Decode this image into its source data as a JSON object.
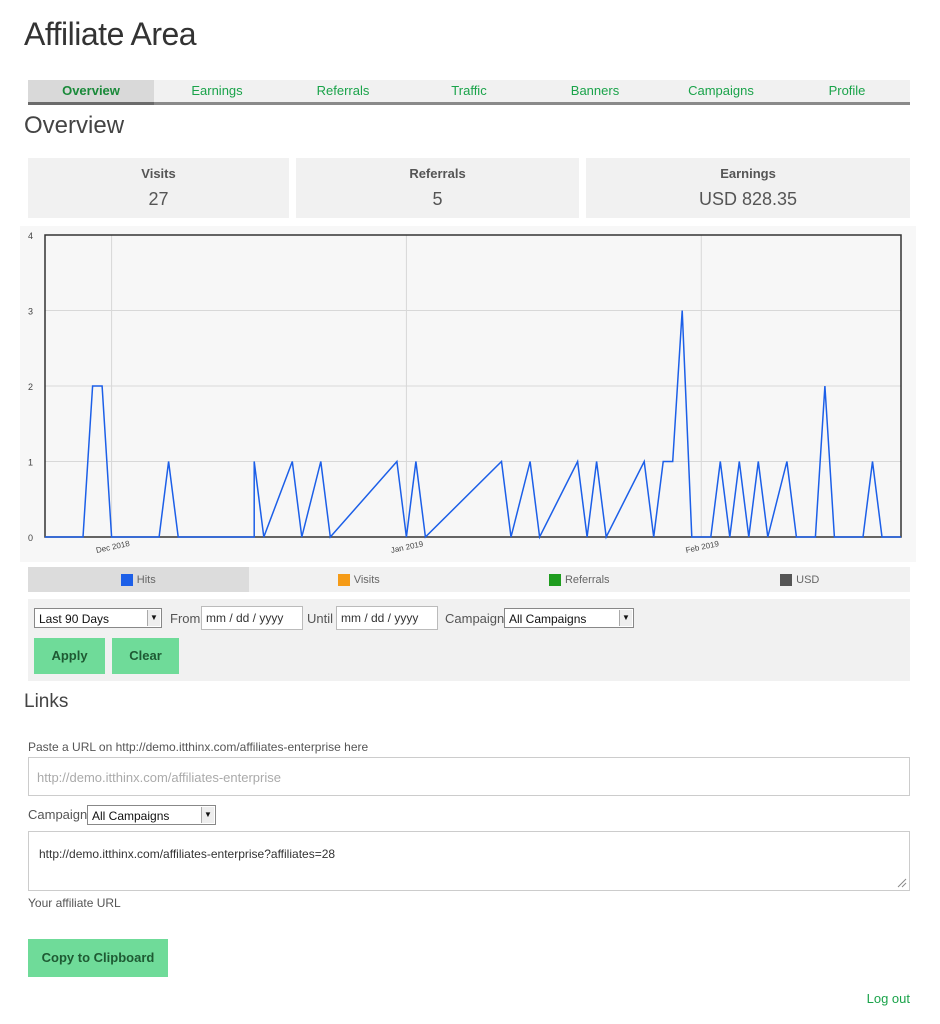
{
  "title": "Affiliate Area",
  "tabs": [
    {
      "label": "Overview",
      "active": true
    },
    {
      "label": "Earnings"
    },
    {
      "label": "Referrals"
    },
    {
      "label": "Traffic"
    },
    {
      "label": "Banners"
    },
    {
      "label": "Campaigns"
    },
    {
      "label": "Profile"
    }
  ],
  "overview_heading": "Overview",
  "stats": {
    "visits": {
      "label": "Visits",
      "value": "27"
    },
    "referrals": {
      "label": "Referrals",
      "value": "5"
    },
    "earnings": {
      "label": "Earnings",
      "value": "USD 828.35"
    }
  },
  "chart_data": {
    "type": "line",
    "ylim": [
      0,
      4
    ],
    "yticks": [
      0,
      1,
      2,
      3,
      4
    ],
    "xticks": [
      {
        "label": "Dec 2018",
        "day": 7
      },
      {
        "label": "Jan 2019",
        "day": 38
      },
      {
        "label": "Feb 2019",
        "day": 69
      }
    ],
    "x_days": 90,
    "grid": true,
    "series": [
      {
        "name": "Hits",
        "color": "#1c5fe8",
        "points": [
          [
            0,
            0
          ],
          [
            4,
            0
          ],
          [
            5,
            2
          ],
          [
            6,
            2
          ],
          [
            7,
            0
          ],
          [
            12,
            0
          ],
          [
            13,
            1
          ],
          [
            14,
            0
          ],
          [
            22,
            0
          ],
          [
            22,
            1
          ],
          [
            23,
            0
          ],
          [
            26,
            1
          ],
          [
            27,
            0
          ],
          [
            29,
            1
          ],
          [
            30,
            0
          ],
          [
            37,
            1
          ],
          [
            38,
            0
          ],
          [
            39,
            1
          ],
          [
            40,
            0
          ],
          [
            48,
            1
          ],
          [
            49,
            0
          ],
          [
            51,
            1
          ],
          [
            52,
            0
          ],
          [
            56,
            1
          ],
          [
            57,
            0
          ],
          [
            58,
            1
          ],
          [
            59,
            0
          ],
          [
            63,
            1
          ],
          [
            64,
            0
          ],
          [
            65,
            1
          ],
          [
            66,
            1
          ],
          [
            67,
            3
          ],
          [
            68,
            0
          ],
          [
            70,
            0
          ],
          [
            71,
            1
          ],
          [
            72,
            0
          ],
          [
            73,
            1
          ],
          [
            74,
            0
          ],
          [
            75,
            1
          ],
          [
            76,
            0
          ],
          [
            78,
            1
          ],
          [
            79,
            0
          ],
          [
            81,
            0
          ],
          [
            82,
            2
          ],
          [
            83,
            0
          ],
          [
            86,
            0
          ],
          [
            87,
            1
          ],
          [
            88,
            0
          ],
          [
            90,
            0
          ]
        ]
      }
    ]
  },
  "legend": [
    {
      "label": "Hits",
      "color": "#1c5fe8",
      "active": true
    },
    {
      "label": "Visits",
      "color": "#f59b17"
    },
    {
      "label": "Referrals",
      "color": "#1e9c1e"
    },
    {
      "label": "USD",
      "color": "#555555"
    }
  ],
  "filters": {
    "range_value": "Last 90 Days",
    "from_label": "From",
    "from_placeholder": "mm / dd / yyyy",
    "until_label": "Until",
    "until_placeholder": "mm / dd / yyyy",
    "campaign_label": "Campaign",
    "campaign_value": "All Campaigns",
    "apply_label": "Apply",
    "clear_label": "Clear"
  },
  "links": {
    "heading": "Links",
    "paste_label": "Paste a URL on http://demo.itthinx.com/affiliates-enterprise here",
    "url_placeholder": "http://demo.itthinx.com/affiliates-enterprise",
    "campaign_label": "Campaign",
    "campaign_value": "All Campaigns",
    "affiliate_url": "http://demo.itthinx.com/affiliates-enterprise?affiliates=28",
    "your_url_label": "Your affiliate URL",
    "copy_label": "Copy to Clipboard"
  },
  "logout_label": "Log out"
}
